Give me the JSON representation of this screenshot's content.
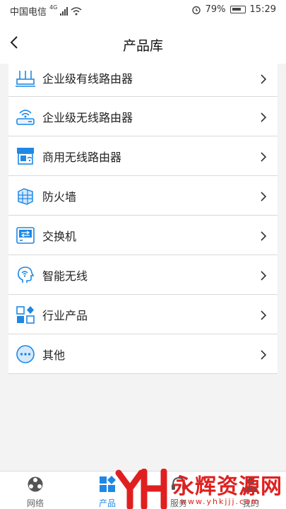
{
  "status": {
    "carrier": "中国电信",
    "network": "4G",
    "battery": "79%",
    "time": "15:29"
  },
  "header": {
    "title": "产品库"
  },
  "products": [
    {
      "label": "企业级有线路由器",
      "icon": "wired-router-icon"
    },
    {
      "label": "企业级无线路由器",
      "icon": "wireless-router-icon"
    },
    {
      "label": "商用无线路由器",
      "icon": "commercial-router-icon"
    },
    {
      "label": "防火墙",
      "icon": "firewall-icon"
    },
    {
      "label": "交换机",
      "icon": "switch-icon"
    },
    {
      "label": "智能无线",
      "icon": "smart-wireless-icon"
    },
    {
      "label": "行业产品",
      "icon": "industry-products-icon"
    },
    {
      "label": "其他",
      "icon": "more-icon"
    }
  ],
  "tabs": [
    {
      "label": "网络",
      "icon": "network-icon"
    },
    {
      "label": "产品",
      "icon": "products-icon",
      "active": true
    },
    {
      "label": "服务",
      "icon": "service-icon"
    },
    {
      "label": "我的",
      "icon": "profile-icon"
    }
  ],
  "watermark": {
    "text": "永辉资源网",
    "url": "www.yhkjjj.com"
  },
  "colors": {
    "accent": "#1e88e5",
    "watermark": "#e02020"
  }
}
